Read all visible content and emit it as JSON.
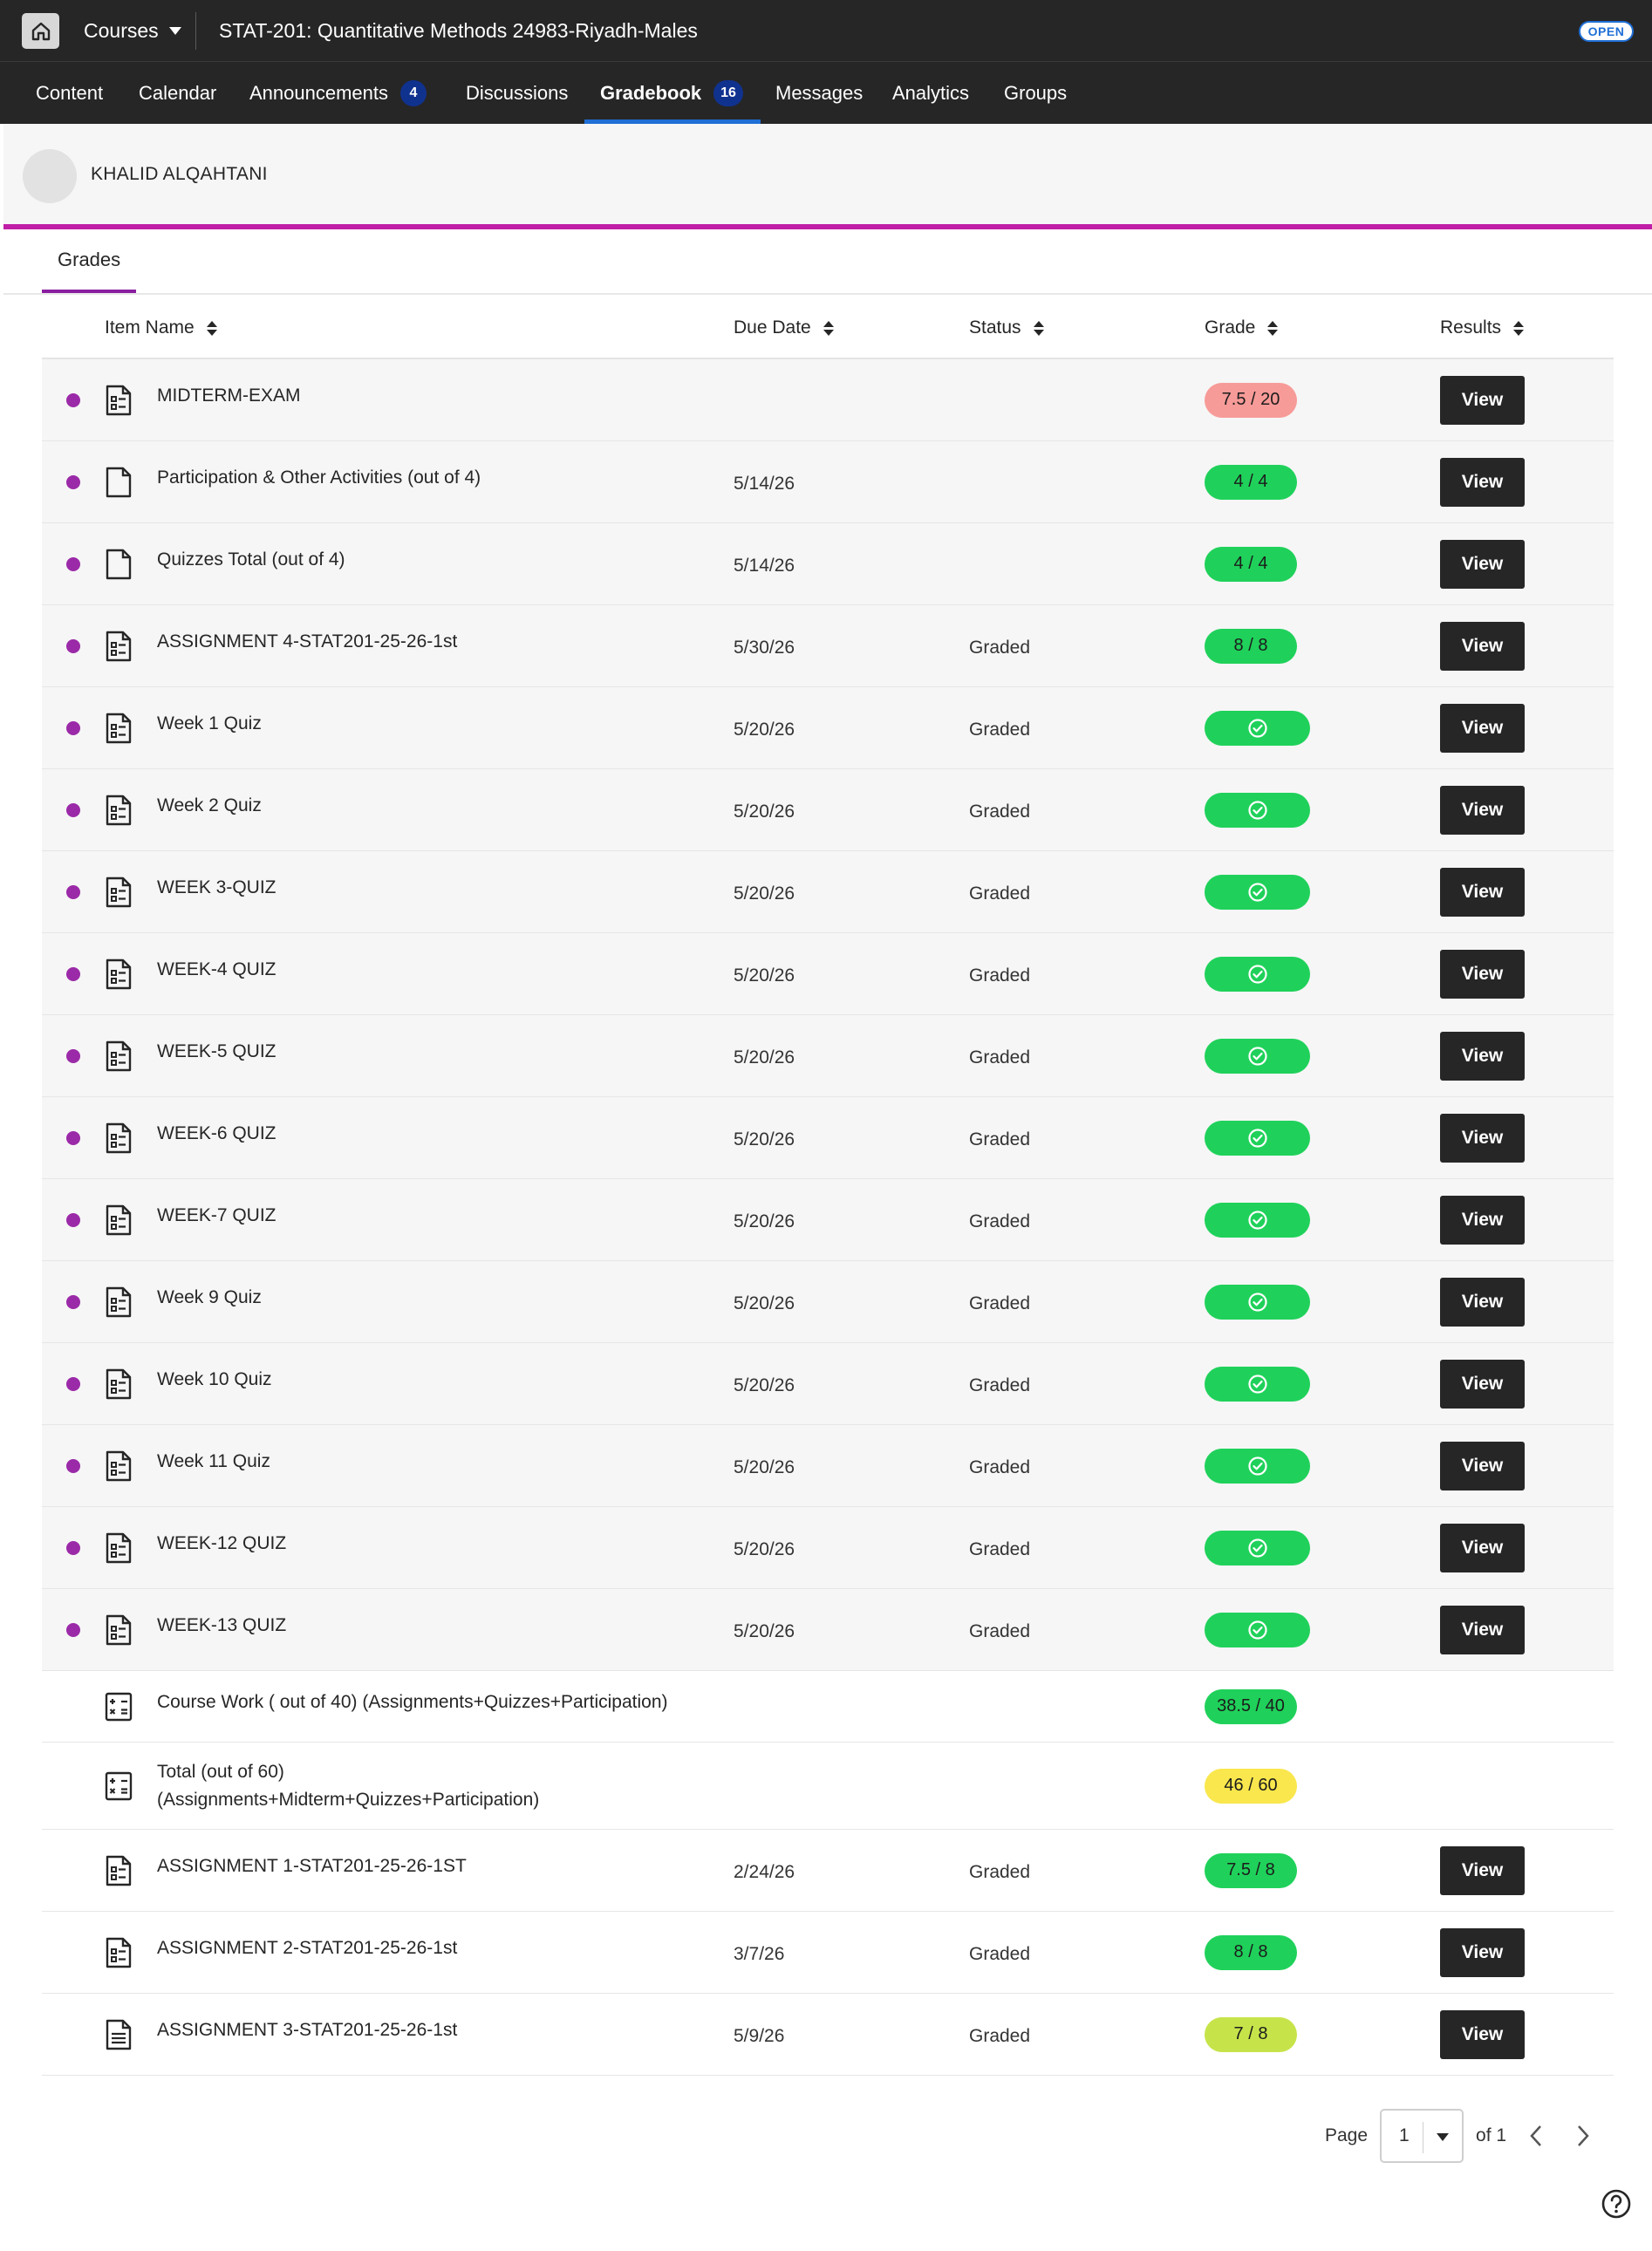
{
  "topbar": {
    "courses_label": "Courses",
    "course_title": "STAT-201: Quantitative Methods 24983-Riyadh-Males",
    "open_badge": "OPEN"
  },
  "nav": {
    "tabs": [
      {
        "label": "Content",
        "badge": ""
      },
      {
        "label": "Calendar",
        "badge": ""
      },
      {
        "label": "Announcements",
        "badge": "4"
      },
      {
        "label": "Discussions",
        "badge": ""
      },
      {
        "label": "Gradebook",
        "badge": "16",
        "active": true
      },
      {
        "label": "Messages",
        "badge": ""
      },
      {
        "label": "Analytics",
        "badge": ""
      },
      {
        "label": "Groups",
        "badge": ""
      }
    ]
  },
  "user": {
    "name": "KHALID ALQAHTANI"
  },
  "grades_tab": "Grades",
  "table": {
    "columns": [
      "Item Name",
      "Due Date",
      "Status",
      "Grade",
      "Results"
    ],
    "rows": [
      {
        "name": "MIDTERM-EXAM",
        "due": "",
        "status": "",
        "grade": "7.5 / 20",
        "grade_color": "#f79b98",
        "icon": "assessment-icon",
        "dot": true,
        "view": "View"
      },
      {
        "name": "Participation & Other Activities (out of 4)",
        "due": "5/14/26",
        "status": "",
        "grade": "4 / 4",
        "grade_color": "#1fd15a",
        "icon": "document-icon",
        "dot": true,
        "view": "View"
      },
      {
        "name": "Quizzes Total (out of 4)",
        "due": "5/14/26",
        "status": "",
        "grade": "4 / 4",
        "grade_color": "#1fd15a",
        "icon": "document-icon",
        "dot": true,
        "view": "View"
      },
      {
        "name": "ASSIGNMENT 4-STAT201-25-26-1st",
        "due": "5/30/26",
        "status": "Graded",
        "grade": "8 / 8",
        "grade_color": "#1fd15a",
        "icon": "assessment-icon",
        "dot": true,
        "view": "View"
      },
      {
        "name": "Week 1 Quiz",
        "due": "5/20/26",
        "status": "Graded",
        "grade": "",
        "grade_color": "#1fd15a",
        "icon": "assessment-icon",
        "dot": true,
        "view": "View"
      },
      {
        "name": "Week 2 Quiz",
        "due": "5/20/26",
        "status": "Graded",
        "grade": "",
        "grade_color": "#1fd15a",
        "icon": "assessment-icon",
        "dot": true,
        "view": "View"
      },
      {
        "name": "WEEK 3-QUIZ",
        "due": "5/20/26",
        "status": "Graded",
        "grade": "",
        "grade_color": "#1fd15a",
        "icon": "assessment-icon",
        "dot": true,
        "view": "View"
      },
      {
        "name": "WEEK-4 QUIZ",
        "due": "5/20/26",
        "status": "Graded",
        "grade": "",
        "grade_color": "#1fd15a",
        "icon": "assessment-icon",
        "dot": true,
        "view": "View"
      },
      {
        "name": "WEEK-5 QUIZ",
        "due": "5/20/26",
        "status": "Graded",
        "grade": "",
        "grade_color": "#1fd15a",
        "icon": "assessment-icon",
        "dot": true,
        "view": "View"
      },
      {
        "name": "WEEK-6 QUIZ",
        "due": "5/20/26",
        "status": "Graded",
        "grade": "",
        "grade_color": "#1fd15a",
        "icon": "assessment-icon",
        "dot": true,
        "view": "View"
      },
      {
        "name": "WEEK-7 QUIZ",
        "due": "5/20/26",
        "status": "Graded",
        "grade": "",
        "grade_color": "#1fd15a",
        "icon": "assessment-icon",
        "dot": true,
        "view": "View"
      },
      {
        "name": "Week 9 Quiz",
        "due": "5/20/26",
        "status": "Graded",
        "grade": "",
        "grade_color": "#1fd15a",
        "icon": "assessment-icon",
        "dot": true,
        "view": "View"
      },
      {
        "name": "Week 10 Quiz",
        "due": "5/20/26",
        "status": "Graded",
        "grade": "",
        "grade_color": "#1fd15a",
        "icon": "assessment-icon",
        "dot": true,
        "view": "View"
      },
      {
        "name": "Week 11 Quiz",
        "due": "5/20/26",
        "status": "Graded",
        "grade": "",
        "grade_color": "#1fd15a",
        "icon": "assessment-icon",
        "dot": true,
        "view": "View"
      },
      {
        "name": "WEEK-12 QUIZ",
        "due": "5/20/26",
        "status": "Graded",
        "grade": "",
        "grade_color": "#1fd15a",
        "icon": "assessment-icon",
        "dot": true,
        "view": "View"
      },
      {
        "name": "WEEK-13 QUIZ",
        "due": "5/20/26",
        "status": "Graded",
        "grade": "",
        "grade_color": "#1fd15a",
        "icon": "assessment-icon",
        "dot": true,
        "view": "View"
      },
      {
        "name": "Course Work ( out of 40) (Assignments+Quizzes+Participation)",
        "due": "",
        "status": "",
        "grade": "38.5 / 40",
        "grade_color": "#1fd15a",
        "icon": "calculator-icon",
        "dot": false,
        "view": ""
      },
      {
        "name": "Total (out of 60)",
        "name2": "(Assignments+Midterm+Quizzes+Participation)",
        "due": "",
        "status": "",
        "grade": "46 / 60",
        "grade_color": "#f9e74d",
        "icon": "calculator-icon",
        "dot": false,
        "view": ""
      },
      {
        "name": "ASSIGNMENT 1-STAT201-25-26-1ST",
        "due": "2/24/26",
        "status": "Graded",
        "grade": "7.5 / 8",
        "grade_color": "#1fd15a",
        "icon": "assessment-icon",
        "dot": false,
        "view": "View"
      },
      {
        "name": "ASSIGNMENT 2-STAT201-25-26-1st",
        "due": "3/7/26",
        "status": "Graded",
        "grade": "8 / 8",
        "grade_color": "#1fd15a",
        "icon": "assessment-icon",
        "dot": false,
        "view": "View"
      },
      {
        "name": "ASSIGNMENT 3-STAT201-25-26-1st",
        "due": "5/9/26",
        "status": "Graded",
        "grade": "7 / 8",
        "grade_color": "#c6e44a",
        "icon": "document-lines-icon",
        "dot": false,
        "view": "View"
      }
    ]
  },
  "pager": {
    "page_label": "Page",
    "current": "1",
    "of_label": "of 1"
  }
}
